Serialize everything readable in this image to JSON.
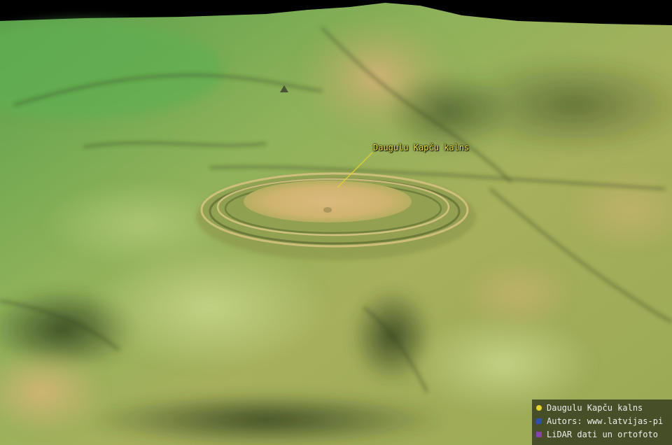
{
  "map": {
    "colors": {
      "low": "#5aa24a",
      "mid": "#a9b45a",
      "high": "#d8b77a",
      "shadow": "#2b3a1c",
      "sky": "#000000"
    },
    "callout": {
      "label": "Daugulu Kapču kalns",
      "color": "#f2e23a"
    },
    "legend": {
      "items": [
        {
          "label": "Daugulu Kapču kalns",
          "color": "#e6d428",
          "icon": "circle-marker-icon"
        },
        {
          "label": "Autors: www.latvijas-pi",
          "color": "#2f4fb0",
          "icon": "square-marker-icon"
        },
        {
          "label": "LiDAR dati un ortofoto",
          "color": "#8a3fb0",
          "icon": "square-marker-icon"
        }
      ]
    }
  }
}
